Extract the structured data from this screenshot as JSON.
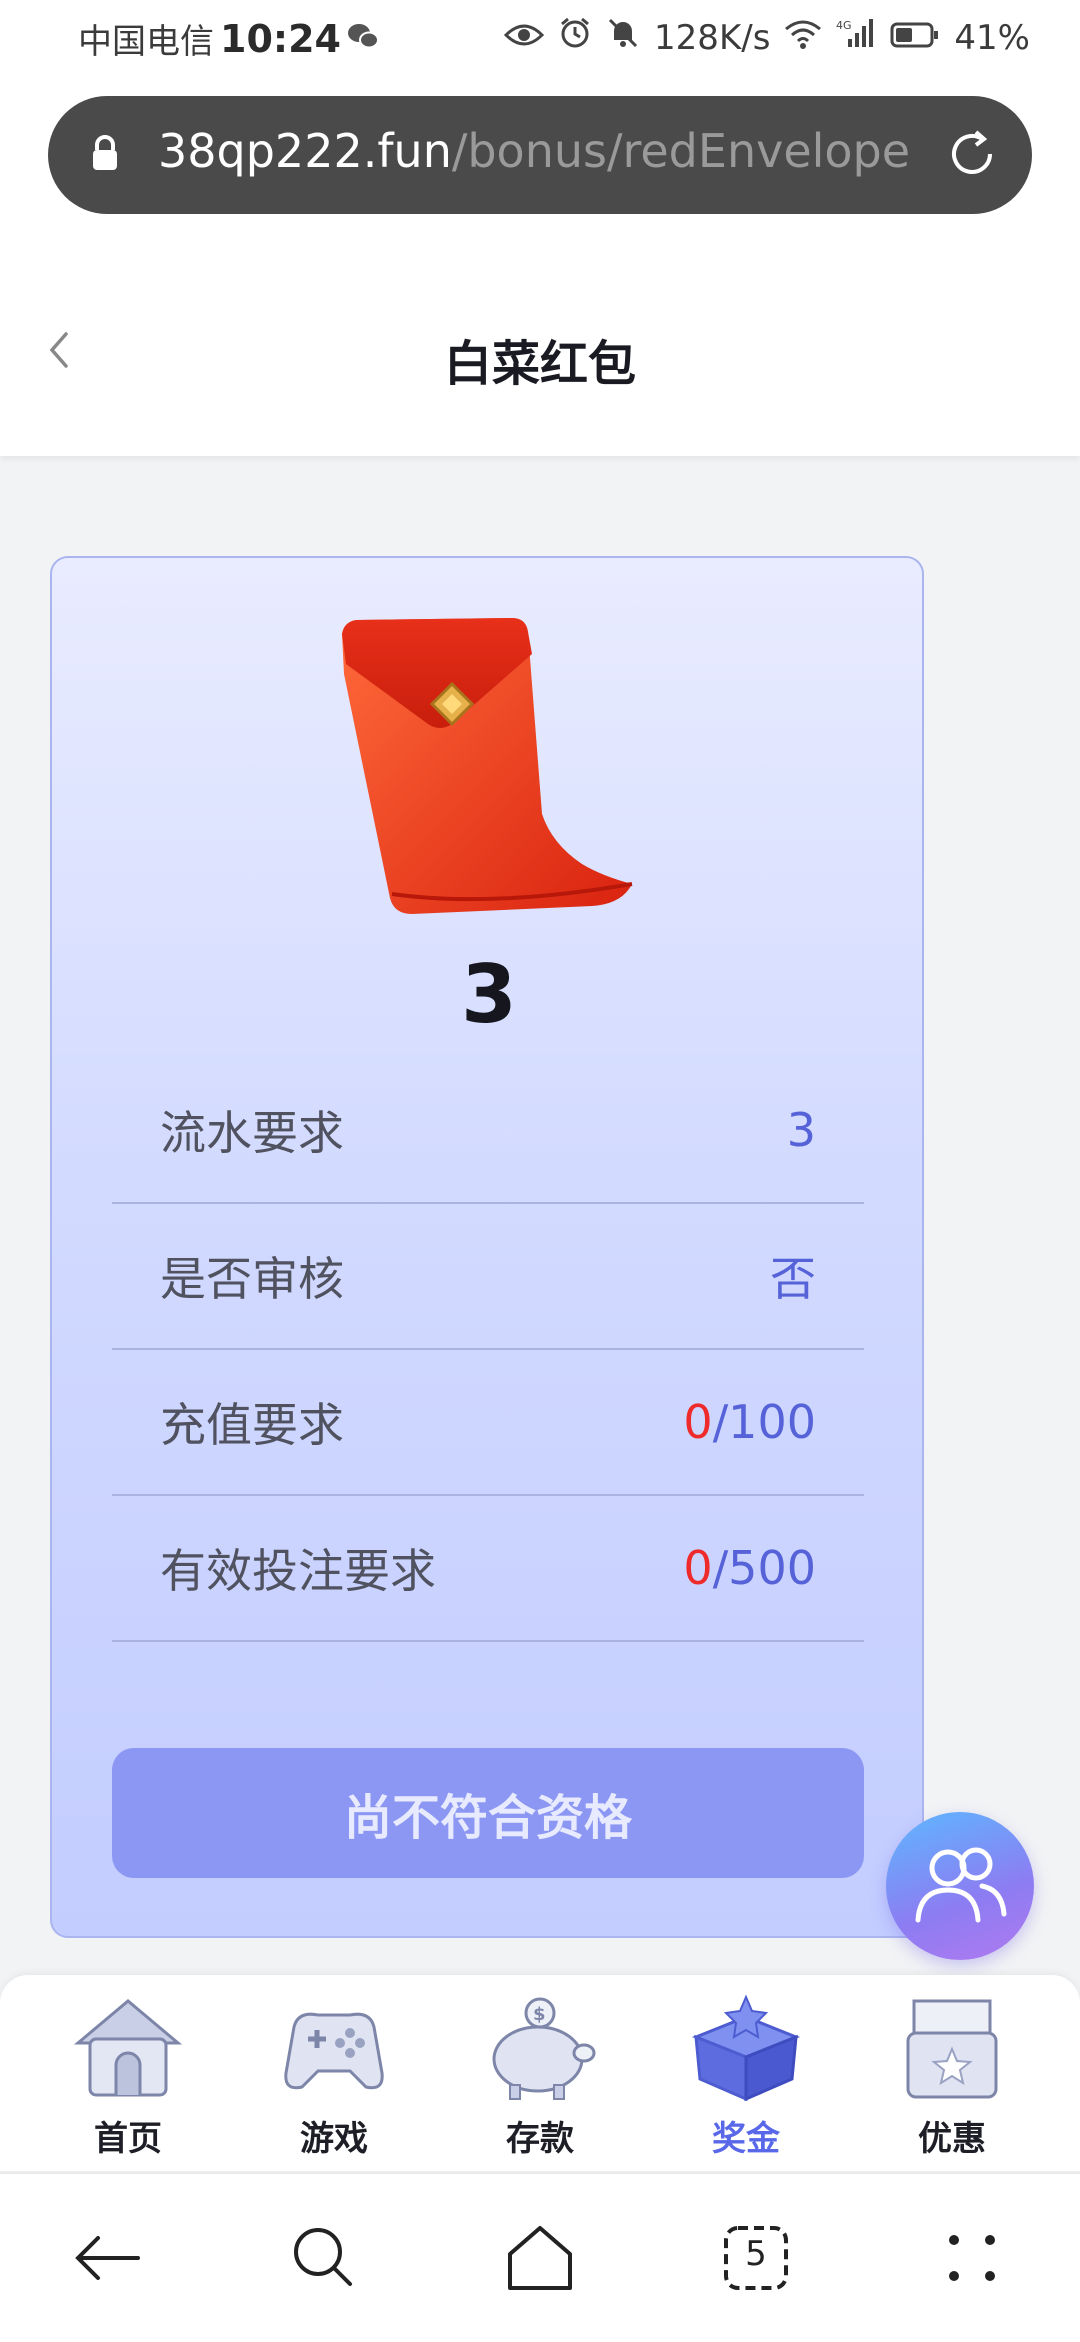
{
  "status_bar": {
    "carrier": "中国电信",
    "time": "10:24",
    "net_speed": "128K/s",
    "battery": "41%"
  },
  "browser": {
    "url_domain": "38qp222.fun",
    "url_path": "/bonus/redEnvelope",
    "tab_count": "5"
  },
  "page": {
    "title": "白菜红包"
  },
  "bonus": {
    "amount": "3",
    "rows": [
      {
        "label": "流水要求",
        "value": "3"
      },
      {
        "label": "是否审核",
        "value": "否"
      },
      {
        "label": "充值要求",
        "current": "0",
        "target": "/100"
      },
      {
        "label": "有效投注要求",
        "current": "0",
        "target": "/500"
      }
    ],
    "button_label": "尚不符合资格"
  },
  "tabbar": {
    "items": [
      {
        "label": "首页",
        "icon": "house-icon"
      },
      {
        "label": "游戏",
        "icon": "gamepad-icon"
      },
      {
        "label": "存款",
        "icon": "piggy-bank-icon"
      },
      {
        "label": "奖金",
        "icon": "gift-box-icon",
        "active": true
      },
      {
        "label": "优惠",
        "icon": "coupon-icon"
      }
    ]
  },
  "colors": {
    "accent": "#5868e8",
    "requirement_current": "#ee2a2a",
    "button_bg": "#8b97f3",
    "card_border": "#aab5ef"
  }
}
